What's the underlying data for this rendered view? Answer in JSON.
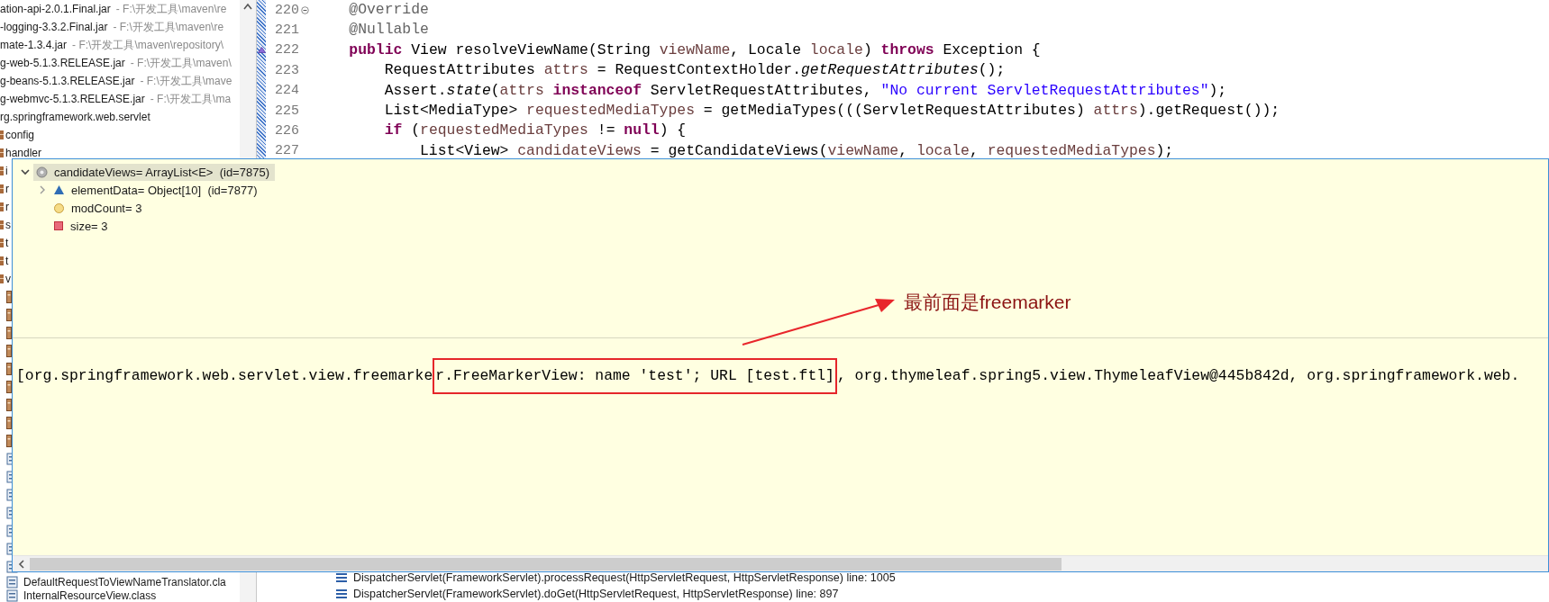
{
  "explorer": {
    "rows": [
      {
        "kind": "jar",
        "label": "ation-api-2.0.1.Final.jar",
        "path": "- F:\\开发工具\\maven\\re"
      },
      {
        "kind": "jar",
        "label": "-logging-3.3.2.Final.jar",
        "path": "- F:\\开发工具\\maven\\re"
      },
      {
        "kind": "jar",
        "label": "mate-1.3.4.jar",
        "path": "- F:\\开发工具\\maven\\repository\\"
      },
      {
        "kind": "jar",
        "label": "g-web-5.1.3.RELEASE.jar",
        "path": "- F:\\开发工具\\maven\\"
      },
      {
        "kind": "jar",
        "label": "g-beans-5.1.3.RELEASE.jar",
        "path": "- F:\\开发工具\\mave"
      },
      {
        "kind": "jar",
        "label": "g-webmvc-5.1.3.RELEASE.jar",
        "path": "- F:\\开发工具\\ma"
      },
      {
        "kind": "package-root",
        "label": "rg.springframework.web.servlet"
      },
      {
        "kind": "package",
        "label": "config"
      },
      {
        "kind": "package",
        "label": "handler"
      },
      {
        "kind": "package",
        "label": "i"
      },
      {
        "kind": "package",
        "label": "r"
      },
      {
        "kind": "package",
        "label": "r"
      },
      {
        "kind": "package",
        "label": "s"
      },
      {
        "kind": "package",
        "label": "t"
      },
      {
        "kind": "package",
        "label": "t"
      },
      {
        "kind": "package",
        "label": "v"
      },
      {
        "kind": "file"
      },
      {
        "kind": "file"
      },
      {
        "kind": "file"
      },
      {
        "kind": "file"
      },
      {
        "kind": "file"
      },
      {
        "kind": "file"
      },
      {
        "kind": "file"
      },
      {
        "kind": "file"
      },
      {
        "kind": "file"
      },
      {
        "kind": "class-file"
      },
      {
        "kind": "class-file"
      },
      {
        "kind": "class-file"
      },
      {
        "kind": "class-file"
      },
      {
        "kind": "class-file"
      },
      {
        "kind": "class-file"
      },
      {
        "kind": "class-file"
      },
      {
        "kind": "class-file",
        "label": "DefaultRequestToViewNameTranslator.cla"
      },
      {
        "kind": "class-file",
        "label": "InternalResourceView.class"
      }
    ]
  },
  "editor": {
    "lines": [
      {
        "number": "220",
        "fold": true,
        "overridden": false,
        "tokens": [
          {
            "kind": "annotation",
            "text": "    @Override"
          }
        ]
      },
      {
        "number": "221",
        "fold": false,
        "overridden": false,
        "tokens": [
          {
            "kind": "annotation",
            "text": "    @Nullable"
          }
        ]
      },
      {
        "number": "222",
        "fold": false,
        "overridden": true,
        "tokens": [
          {
            "kind": "keyword",
            "text": "    public"
          },
          {
            "kind": "plain",
            "text": " View resolveViewName(String "
          },
          {
            "kind": "variable",
            "text": "viewName"
          },
          {
            "kind": "plain",
            "text": ", Locale "
          },
          {
            "kind": "variable",
            "text": "locale"
          },
          {
            "kind": "plain",
            "text": ") "
          },
          {
            "kind": "keyword",
            "text": "throws"
          },
          {
            "kind": "plain",
            "text": " Exception {"
          }
        ]
      },
      {
        "number": "223",
        "fold": false,
        "overridden": false,
        "tokens": [
          {
            "kind": "plain",
            "text": "        RequestAttributes "
          },
          {
            "kind": "variable",
            "text": "attrs"
          },
          {
            "kind": "plain",
            "text": " = RequestContextHolder."
          },
          {
            "kind": "static",
            "text": "getRequestAttributes"
          },
          {
            "kind": "plain",
            "text": "();"
          }
        ]
      },
      {
        "number": "224",
        "fold": false,
        "overridden": false,
        "tokens": [
          {
            "kind": "plain",
            "text": "        Assert."
          },
          {
            "kind": "static",
            "text": "state"
          },
          {
            "kind": "plain",
            "text": "("
          },
          {
            "kind": "variable",
            "text": "attrs"
          },
          {
            "kind": "keyword",
            "text": " instanceof"
          },
          {
            "kind": "plain",
            "text": " ServletRequestAttributes, "
          },
          {
            "kind": "string",
            "text": "\"No current ServletRequestAttributes\""
          },
          {
            "kind": "plain",
            "text": ");"
          }
        ]
      },
      {
        "number": "225",
        "fold": false,
        "overridden": false,
        "tokens": [
          {
            "kind": "plain",
            "text": "        List<MediaType> "
          },
          {
            "kind": "variable",
            "text": "requestedMediaTypes"
          },
          {
            "kind": "plain",
            "text": " = getMediaTypes(((ServletRequestAttributes) "
          },
          {
            "kind": "variable",
            "text": "attrs"
          },
          {
            "kind": "plain",
            "text": ").getRequest());"
          }
        ]
      },
      {
        "number": "226",
        "fold": false,
        "overridden": false,
        "tokens": [
          {
            "kind": "keyword",
            "text": "        if"
          },
          {
            "kind": "plain",
            "text": " ("
          },
          {
            "kind": "variable",
            "text": "requestedMediaTypes"
          },
          {
            "kind": "plain",
            "text": " != "
          },
          {
            "kind": "keyword",
            "text": "null"
          },
          {
            "kind": "plain",
            "text": ") {"
          }
        ]
      },
      {
        "number": "227",
        "fold": false,
        "overridden": false,
        "tokens": [
          {
            "kind": "plain",
            "text": "            List<View> "
          },
          {
            "kind": "variable",
            "text": "candidateViews"
          },
          {
            "kind": "plain",
            "text": " = getCandidateViews("
          },
          {
            "kind": "variable",
            "text": "viewName"
          },
          {
            "kind": "plain",
            "text": ", "
          },
          {
            "kind": "variable",
            "text": "locale"
          },
          {
            "kind": "plain",
            "text": ", "
          },
          {
            "kind": "variable",
            "text": "requestedMediaTypes"
          },
          {
            "kind": "plain",
            "text": ");"
          }
        ]
      }
    ]
  },
  "popup": {
    "variables": [
      {
        "label": "candidateViews= ArrayList<E>  (id=7875)",
        "kind": "local",
        "selected": true,
        "expanded": true,
        "children": [
          {
            "label": "elementData= Object[10]  (id=7877)",
            "kind": "default",
            "selected": false,
            "expanded": false
          },
          {
            "label": "modCount= 3",
            "kind": "protected",
            "selected": false
          },
          {
            "label": "size= 3",
            "kind": "private",
            "selected": false
          }
        ]
      }
    ],
    "detail": {
      "before": "[org.springframework.web.servlet.view.freemarke",
      "highlighted": "r.FreeMarkerView: name 'test'; URL [test.ftl]",
      "after": ", org.thymeleaf.spring5.view.ThymeleafView@445b842d, org.springframework.web."
    }
  },
  "annotation": {
    "text": "最前面是freemarker"
  },
  "stack_frames": [
    {
      "text": "DispatcherServlet(FrameworkServlet).processRequest(HttpServletRequest, HttpServletResponse) line: 1005"
    },
    {
      "text": "DispatcherServlet(FrameworkServlet).doGet(HttpServletRequest, HttpServletResponse) line: 897"
    }
  ]
}
